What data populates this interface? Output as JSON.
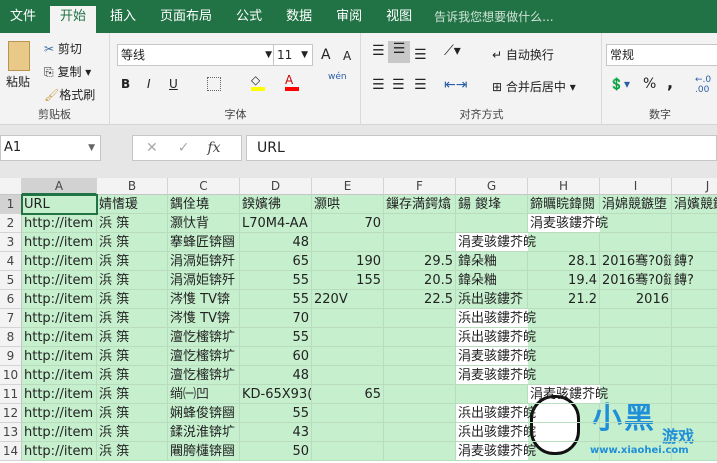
{
  "tabs": [
    "文件",
    "开始",
    "插入",
    "页面布局",
    "公式",
    "数据",
    "审阅",
    "视图"
  ],
  "active_tab": 1,
  "tell_me": "告诉我您想要做什么...",
  "clipboard": {
    "paste": "粘贴",
    "cut": "剪切",
    "copy": "复制",
    "format_painter": "格式刷",
    "label": "剪贴板"
  },
  "font": {
    "name": "等线",
    "size": "11",
    "bold": "B",
    "italic": "I",
    "underline": "U",
    "grow": "A",
    "shrink": "A",
    "color": "A",
    "phonetic": "wén",
    "label": "字体",
    "fill_color": "#ffff00",
    "font_color": "#ff0000"
  },
  "alignment": {
    "wrap": "自动换行",
    "merge": "合并后居中",
    "label": "对齐方式"
  },
  "number": {
    "format": "常规",
    "percent": "%",
    "comma": ",",
    "label": "数字"
  },
  "formula_bar": {
    "name_box": "A1",
    "fx": "fx",
    "value": "URL"
  },
  "columns": [
    "A",
    "B",
    "C",
    "D",
    "E",
    "F",
    "G",
    "H",
    "I",
    "J"
  ],
  "rows": [
    [
      "URL",
      "婧愭瑗",
      "鍝佺墝",
      "鍨嬪彿",
      "灏哄",
      "",
      "鏁存満鍔熻",
      "鍚  鍐埄",
      "鍗曞睆鍏閱",
      "涓婂競鏃堕"
    ],
    [
      "http://item",
      "浜  篊",
      "灏忕背",
      "L70M4-AA",
      "70",
      "",
      "",
      "涓麦骇鏤芥皖",
      "",
      ""
    ],
    [
      "http://item",
      "浜  篊",
      "搴蜂匠锛圝",
      "48",
      "",
      "",
      "涓麦骇鏤芥皖",
      "",
      "",
      ""
    ],
    [
      "http://item",
      "浜  篊",
      "涓滆姖锛歼",
      "65",
      "190",
      "29.5",
      "鍏朵粬",
      "28.1",
      "2016骞?0鏈",
      "鏄?"
    ],
    [
      "http://item",
      "浜  篊",
      "涓滆姖锛歼",
      "55",
      "155",
      "20.5",
      "鍏朵粬",
      "19.4",
      "2016骞?0鏈",
      "鏄?"
    ],
    [
      "http://item",
      "浜  篊",
      "涔愯  TV锛",
      "55",
      "220V",
      "22.5",
      "浜出骇鏤芥",
      "21.2",
      "2016",
      ""
    ],
    [
      "http://item",
      "浜  篊",
      "涔愯  TV锛",
      "70",
      "",
      "",
      "浜出骇鏤芥皖",
      "",
      "",
      ""
    ],
    [
      "http://item",
      "浜  篊",
      "澶忔櫁锛圹",
      "55",
      "",
      "",
      "浜出骇鏤芥皖",
      "",
      "",
      ""
    ],
    [
      "http://item",
      "浜  篊",
      "澶忔櫁锛圹",
      "60",
      "",
      "",
      "涓麦骇鏤芥皖",
      "",
      "",
      ""
    ],
    [
      "http://item",
      "浜  篊",
      "澶忔櫁锛圹",
      "48",
      "",
      "",
      "涓麦骇鏤芥皖",
      "",
      "",
      ""
    ],
    [
      "http://item",
      "浜  篊",
      "绱㈠凹",
      "KD-65X93(",
      "65",
      "",
      "",
      "涓麦骇鏤芥皖",
      "",
      ""
    ],
    [
      "http://item",
      "浜  篊",
      "娴蜂俊锛圝",
      "55",
      "",
      "",
      "浜出骇鏤芥皖",
      "",
      "",
      ""
    ],
    [
      "http://item",
      "浜  篊",
      "鍒涚淮锛圹",
      "43",
      "",
      "",
      "浜出骇鏤芥皖",
      "",
      "",
      ""
    ],
    [
      "http://item",
      "浜  篊",
      "闀胯櫣锛圝",
      "50",
      "",
      "",
      "涓麦骇鏤芥皖",
      "",
      "",
      ""
    ]
  ],
  "header_extra_J": "涓嬪競鏃堕",
  "watermark": {
    "text": "小黑游戏",
    "url": "www.xiaohei.com"
  },
  "colors": {
    "accent": "#217346",
    "cell_fill": "#c6efce"
  }
}
